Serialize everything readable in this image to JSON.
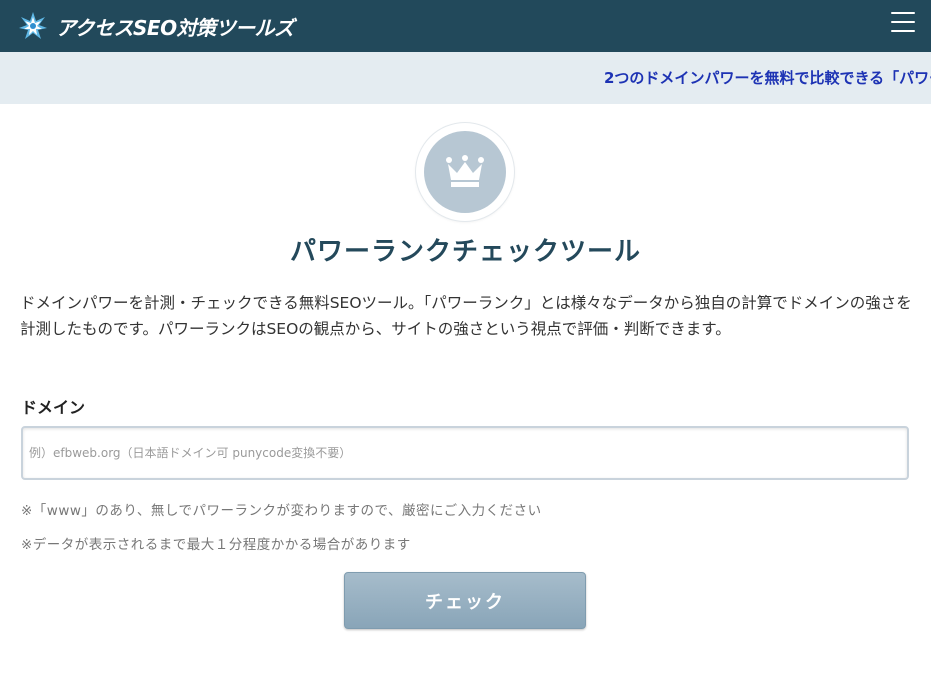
{
  "header": {
    "site_name": "アクセスSEO対策ツールズ",
    "logo_icon": "starburst-logo-icon",
    "menu_icon": "hamburger-menu-icon",
    "background_color": "#22495b"
  },
  "ticker": {
    "text": "2つのドメインパワーを無料で比較できる「パワー",
    "text_color": "#1d33b4",
    "background_color": "#e4ecf1"
  },
  "main": {
    "icon": "crown-icon",
    "title": "パワーランクチェックツール",
    "description": "ドメインパワーを計測・チェックできる無料SEOツール。「パワーランク」とは様々なデータから独自の計算でドメインの強さを計測したものです。パワーランクはSEOの観点から、サイトの強さという視点で評価・判断できます。",
    "form": {
      "domain_label": "ドメイン",
      "domain_placeholder": "例）efbweb.org（日本語ドメイン可 punycode変換不要）",
      "domain_value": "",
      "note_www": "※「www」のあり、無しでパワーランクが変わりますので、厳密にご入力ください",
      "note_time": "※データが表示されるまで最大１分程度かかる場合があります",
      "submit_label": "チェック"
    }
  }
}
